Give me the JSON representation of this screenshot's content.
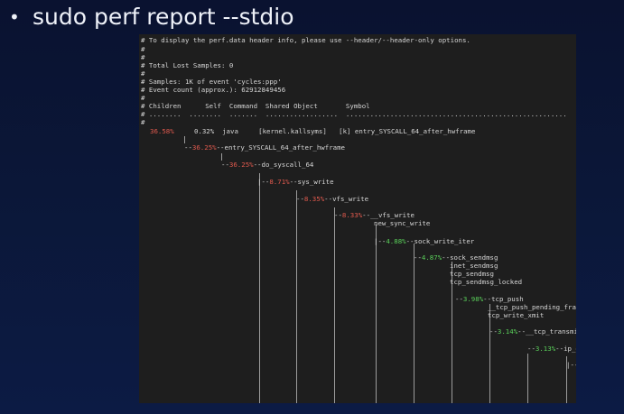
{
  "slide": {
    "bullet": "•",
    "title": "sudo perf report --stdio"
  },
  "terminal": {
    "header": [
      "# To display the perf.data header info, please use --header/--header-only options.",
      "#",
      "#",
      "# Total Lost Samples: 0",
      "#",
      "# Samples: 1K of event 'cycles:ppp'",
      "# Event count (approx.): 62912849456",
      "#",
      "# Children      Self  Command  Shared Object       Symbol",
      "# ........  ........  .......  ..................  .......................................................",
      "#"
    ],
    "top_row": {
      "children": "36.58%",
      "rest": "     0.32%  java     [kernel.kallsyms]   [k] entry_SYSCALL_64_after_hwframe"
    },
    "tree": [
      {
        "prefix": "--",
        "pct": "36.25%",
        "color": "red",
        "sep": "--",
        "name": "entry_SYSCALL_64_after_hwframe"
      },
      {
        "prefix": "--",
        "pct": "36.25%",
        "color": "red",
        "sep": "--",
        "name": "do_syscall_64"
      },
      {
        "prefix": "|--",
        "pct": "8.71%",
        "color": "red",
        "sep": "--",
        "name": "sys_write"
      },
      {
        "prefix": "--",
        "pct": "8.35%",
        "color": "red",
        "sep": "--",
        "name": "vfs_write"
      },
      {
        "prefix": "--",
        "pct": "8.33%",
        "color": "red",
        "sep": "--",
        "name": "__vfs_write"
      },
      {
        "prefix": "",
        "pct": "",
        "color": "",
        "sep": "",
        "name": "new_sync_write"
      },
      {
        "prefix": "|--",
        "pct": "4.88%",
        "color": "green",
        "sep": "--",
        "name": "sock_write_iter"
      },
      {
        "prefix": "--",
        "pct": "4.87%",
        "color": "green",
        "sep": "--",
        "name": "sock_sendmsg"
      },
      {
        "prefix": "",
        "pct": "",
        "color": "",
        "sep": "",
        "name": "inet_sendmsg"
      },
      {
        "prefix": "",
        "pct": "",
        "color": "",
        "sep": "",
        "name": "tcp_sendmsg"
      },
      {
        "prefix": "",
        "pct": "",
        "color": "",
        "sep": "",
        "name": "tcp_sendmsg_locked"
      },
      {
        "prefix": "--",
        "pct": "3.98%",
        "color": "green",
        "sep": "--",
        "name": "tcp_push"
      },
      {
        "prefix": "",
        "pct": "",
        "color": "",
        "sep": "",
        "name": "__tcp_push_pending_frames"
      },
      {
        "prefix": "",
        "pct": "",
        "color": "",
        "sep": "",
        "name": "tcp_write_xmit"
      },
      {
        "prefix": "--",
        "pct": "3.14%",
        "color": "green",
        "sep": "--",
        "name": "__tcp_transmit_"
      },
      {
        "prefix": "--",
        "pct": "3.13%",
        "color": "green",
        "sep": "--",
        "name": "ip_q"
      },
      {
        "prefix": "|--",
        "pct": "",
        "color": "",
        "sep": "",
        "name": ""
      }
    ]
  }
}
